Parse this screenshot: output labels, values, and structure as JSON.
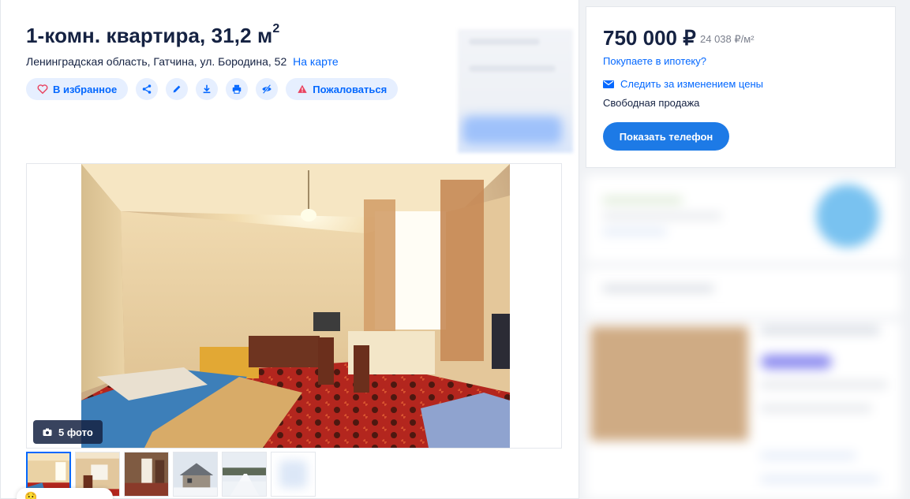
{
  "listing": {
    "title": "1-комн. квартира, 31,2 м",
    "title_sup": "2",
    "address": "Ленинградская область, Гатчина, ул. Бородина, 52",
    "map_link": "На карте"
  },
  "actions": {
    "favorite_label": "В избранное",
    "complain_label": "Пожаловаться",
    "icons": [
      "heart-icon",
      "share-icon",
      "pencil-icon",
      "download-icon",
      "print-icon",
      "hide-icon",
      "warning-icon"
    ]
  },
  "gallery": {
    "photo_count": "5 фото",
    "thumbnails": 6,
    "active_thumbnail": 1
  },
  "price_card": {
    "price": "750 000 ₽",
    "price_per_meter": "24 038 ₽/м²",
    "mortgage_link": "Покупаете в ипотеку?",
    "follow_price": "Следить за изменением цены",
    "sale_type": "Свободная продажа",
    "phone_button": "Показать телефон"
  },
  "colors": {
    "accent": "#0468ff",
    "button": "#1d7ae6",
    "pill_bg": "#e6efff",
    "text": "#152242",
    "page_bg": "#f0f2f5"
  }
}
